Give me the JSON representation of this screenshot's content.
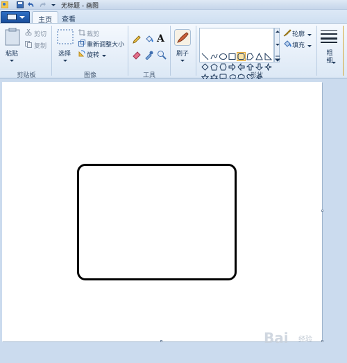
{
  "window": {
    "title": "无标题 - 画图"
  },
  "tabs": [
    {
      "label": "主页",
      "active": true
    },
    {
      "label": "查看",
      "active": false
    }
  ],
  "clipboard": {
    "paste": "粘贴",
    "cut": "剪切",
    "copy": "复制",
    "group": "剪贴板"
  },
  "image": {
    "select": "选择",
    "crop": "裁剪",
    "resize": "重新调整大小",
    "rotate": "旋转",
    "group": "图像"
  },
  "tools": {
    "group": "工具",
    "text_glyph": "A"
  },
  "brushes": {
    "label": "刷子"
  },
  "shapes": {
    "group": "形状",
    "outline": "轮廓",
    "fill": "填充",
    "selected": "rounded-rectangle"
  },
  "size": {
    "label": "粗细"
  },
  "watermark": {
    "text": "Bai",
    "sub": "经验"
  },
  "colors": {
    "accent": "#1a4f9c",
    "shape_stroke": "#000000",
    "canvas": "#ffffff"
  }
}
